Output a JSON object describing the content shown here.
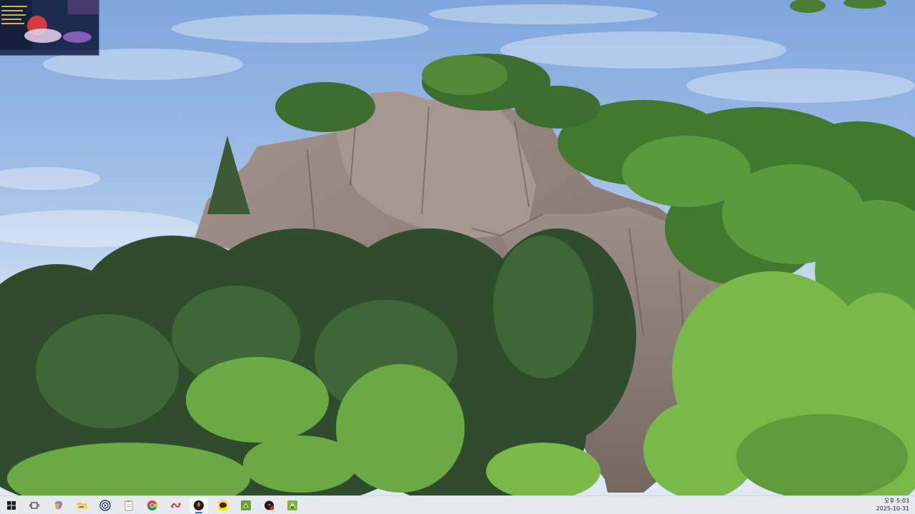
{
  "desktop": {
    "wallpaper": "rock cliff with pine trees under blue sky"
  },
  "taskbar": {
    "apps": [
      {
        "name": "start-icon"
      },
      {
        "name": "task-view-icon"
      },
      {
        "name": "copilot-icon"
      },
      {
        "name": "file-explorer-icon"
      },
      {
        "name": "circular-app-icon"
      },
      {
        "name": "notepad-icon"
      },
      {
        "name": "chrome-icon"
      },
      {
        "name": "red-app-icon"
      },
      {
        "name": "game-app-icon",
        "active": true
      },
      {
        "name": "kakaotalk-icon"
      },
      {
        "name": "launcher-icon-1"
      },
      {
        "name": "game-app-icon-2"
      },
      {
        "name": "launcher-icon-2"
      }
    ],
    "clock": {
      "time": "오후 5:03",
      "date": "2025-10-31"
    }
  },
  "colors": {
    "taskbar_bg": "#e6eaee",
    "accent": "#2a6fd6"
  }
}
